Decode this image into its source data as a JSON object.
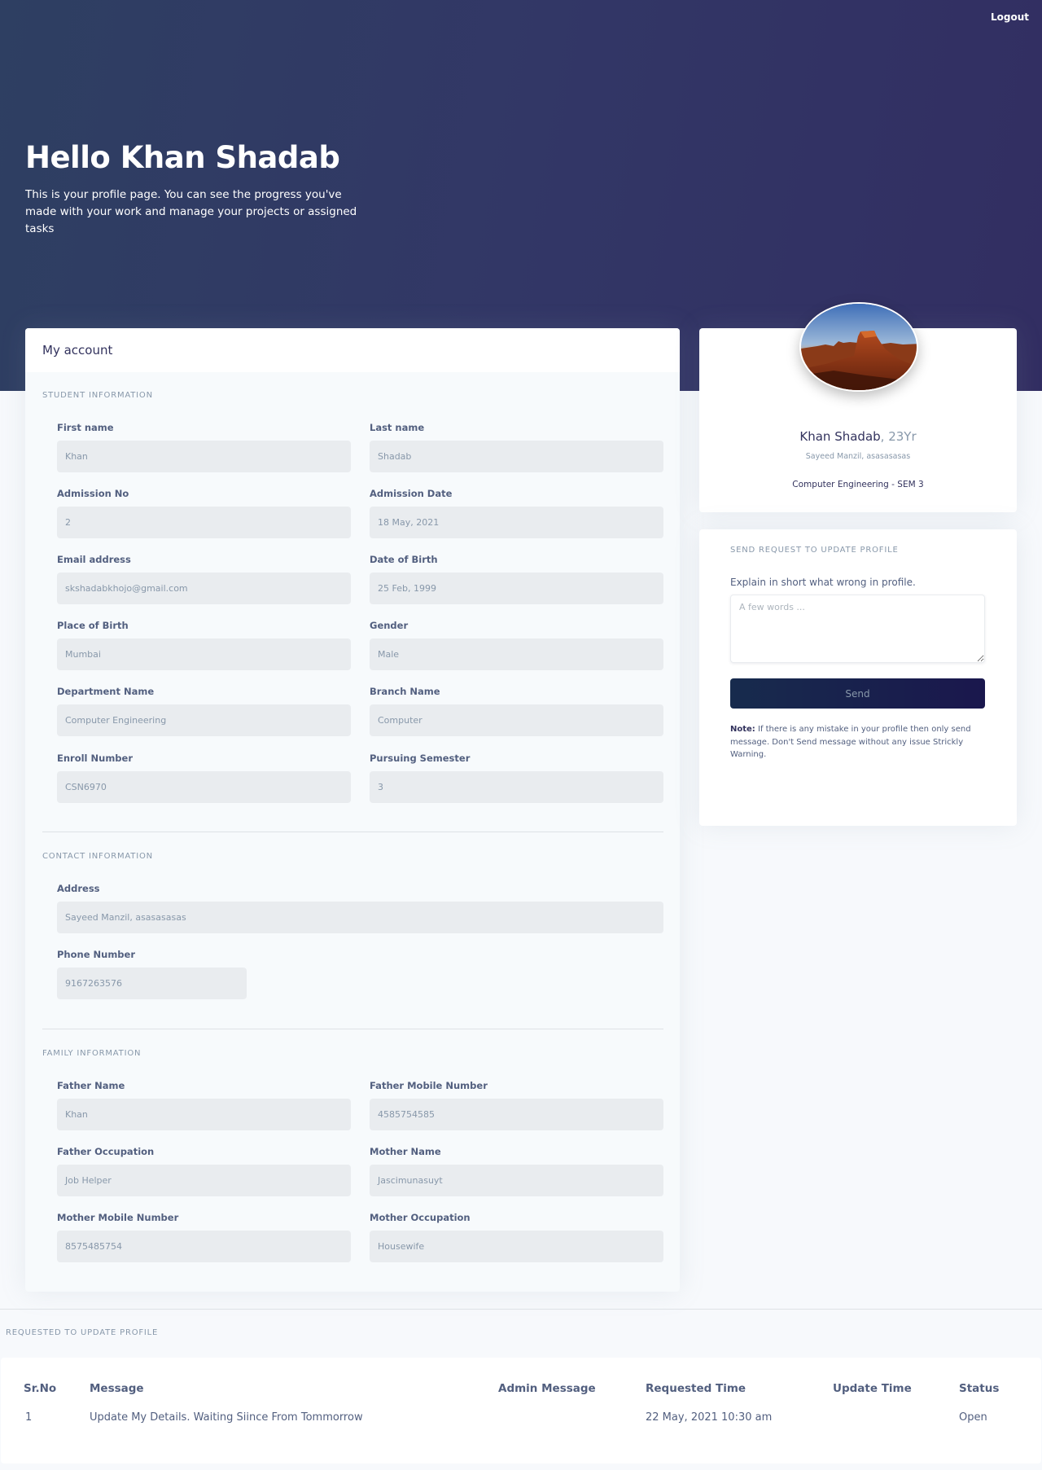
{
  "header": {
    "logout": "Logout",
    "greeting": "Hello Khan Shadab",
    "description": "This is your profile page. You can see the progress you've made with your work and manage your projects or assigned tasks"
  },
  "account": {
    "title": "My account",
    "student_section": "Student information",
    "contact_section": "Contact information",
    "family_section": "Family information",
    "fields": {
      "first_name": {
        "label": "First name",
        "value": "Khan"
      },
      "last_name": {
        "label": "Last name",
        "value": "Shadab"
      },
      "admission_no": {
        "label": "Admission No",
        "value": "2"
      },
      "admission_date": {
        "label": "Admission Date",
        "value": "18 May, 2021"
      },
      "email": {
        "label": "Email address",
        "value": "skshadabkhojo@gmail.com"
      },
      "dob": {
        "label": "Date of Birth",
        "value": "25 Feb, 1999"
      },
      "place_of_birth": {
        "label": "Place of Birth",
        "value": "Mumbai"
      },
      "gender": {
        "label": "Gender",
        "value": "Male"
      },
      "department": {
        "label": "Department Name",
        "value": "Computer Engineering"
      },
      "branch": {
        "label": "Branch Name",
        "value": "Computer"
      },
      "enroll": {
        "label": "Enroll Number",
        "value": "CSN6970"
      },
      "semester": {
        "label": "Pursuing Semester",
        "value": "3"
      },
      "address": {
        "label": "Address",
        "value": "Sayeed Manzil, asasasasas"
      },
      "phone": {
        "label": "Phone Number",
        "value": "9167263576"
      },
      "father_name": {
        "label": "Father Name",
        "value": "Khan"
      },
      "father_mobile": {
        "label": "Father Mobile Number",
        "value": "4585754585"
      },
      "father_occupation": {
        "label": "Father Occupation",
        "value": "Job Helper"
      },
      "mother_name": {
        "label": "Mother Name",
        "value": "Jascimunasuyt"
      },
      "mother_mobile": {
        "label": "Mother Mobile Number",
        "value": "8575485754"
      },
      "mother_occupation": {
        "label": "Mother Occupation",
        "value": "Housewife"
      }
    }
  },
  "profile": {
    "name": "Khan Shadab",
    "age": ", 23Yr",
    "address": "Sayeed Manzil, asasasasas",
    "department": "Computer Engineering - SEM 3"
  },
  "request_form": {
    "title": "Send request to update profile",
    "prompt": "Explain in short what wrong in profile.",
    "placeholder": "A few words ...",
    "send_label": "Send",
    "note_label": "Note:",
    "note_text": " If there is any mistake in your profile then only send message. Don't Send message without any issue Strickly Warning."
  },
  "requests": {
    "title": "Requested to update profile",
    "columns": [
      "Sr.No",
      "Message",
      "Admin Message",
      "Requested Time",
      "Update Time",
      "Status"
    ],
    "rows": [
      {
        "sr": "1",
        "message": "Update My Details. Waiting Siince From Tommorrow",
        "admin_message": "",
        "requested_time": "22 May, 2021 10:30 am",
        "update_time": "",
        "status": "Open"
      }
    ]
  }
}
